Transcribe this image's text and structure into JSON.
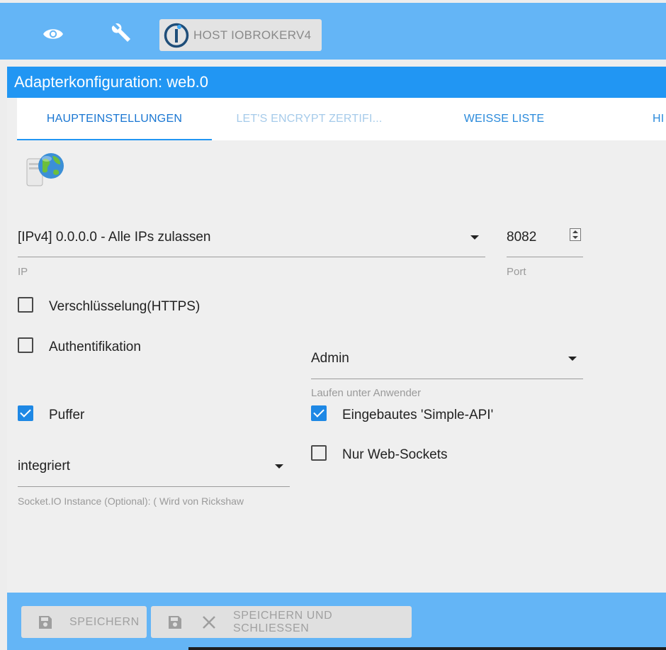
{
  "toolbar": {
    "eye_icon": "eye-icon",
    "wrench_icon": "wrench-icon",
    "host_label": "HOST IOBROKERV4"
  },
  "dialog": {
    "title": "Adapterkonfiguration: web.0"
  },
  "tabs": [
    {
      "label": "HAUPTEINSTELLUNGEN",
      "state": "active"
    },
    {
      "label": "LET'S ENCRYPT ZERTIFI...",
      "state": "disabled"
    },
    {
      "label": "WEISSE LISTE",
      "state": "normal"
    },
    {
      "label": "HI",
      "state": "normal"
    }
  ],
  "form": {
    "ip": {
      "value": "[IPv4] 0.0.0.0 - Alle IPs zulassen",
      "helper": "IP"
    },
    "port": {
      "value": "8082",
      "helper": "Port"
    },
    "https": {
      "label": "Verschlüsselung(HTTPS)",
      "checked": false
    },
    "auth": {
      "label": "Authentifikation",
      "checked": false
    },
    "run_as": {
      "value": "Admin",
      "helper": "Laufen unter Anwender"
    },
    "cache": {
      "label": "Puffer",
      "checked": true
    },
    "simple_api": {
      "label": "Eingebautes 'Simple-API'",
      "checked": true
    },
    "socket_io": {
      "value": "integriert",
      "helper": "Socket.IO Instance (Optional): (      Wird von Rickshaw"
    },
    "web_sockets": {
      "label": "Nur Web-Sockets",
      "checked": false
    }
  },
  "footer": {
    "save_label": "SPEICHERN",
    "save_close_label": "SPEICHERN UND SCHLIESSEN"
  },
  "colors": {
    "toolbar_bg": "#64b5f6",
    "title_bg": "#2196f3",
    "accent": "#1e88e5"
  }
}
